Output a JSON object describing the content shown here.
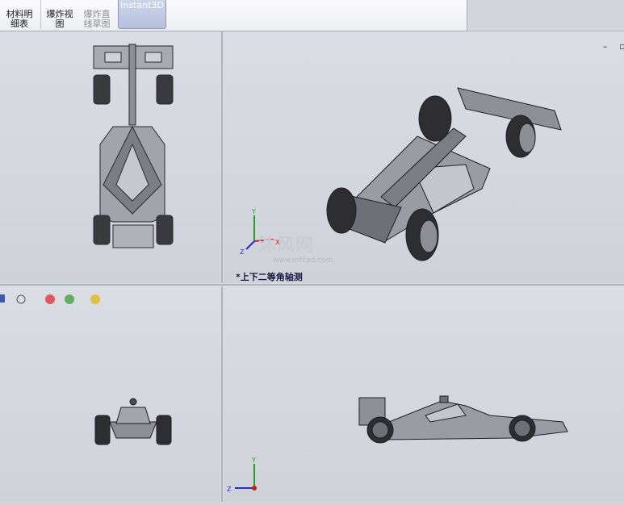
{
  "toolbar": {
    "bom_label": "材料明\n细表",
    "explode_label": "爆炸视\n图",
    "explode_sketch_label": "爆炸直\n线草图",
    "instant3d_label": "Instant3D"
  },
  "viewports": {
    "iso_label": "*上下二等角轴测"
  },
  "watermark": {
    "big": "沐风网",
    "small": "www.mfcad.com"
  },
  "window_controls": {
    "minimize": "–",
    "restore": "▫"
  },
  "triad": {
    "x": "X",
    "y": "Y",
    "z": "Z"
  }
}
